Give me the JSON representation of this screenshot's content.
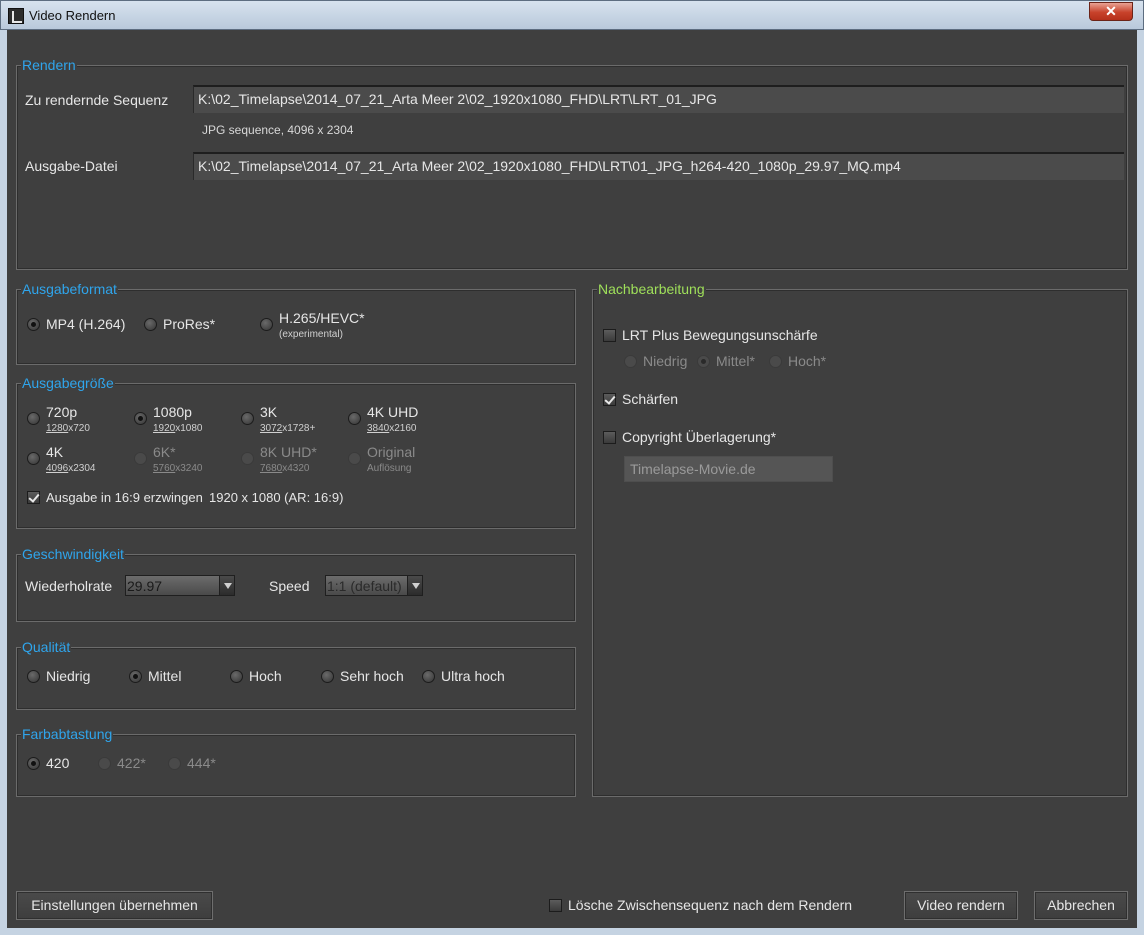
{
  "window": {
    "title": "Video Rendern",
    "close_symbol": "✕"
  },
  "render": {
    "legend": "Rendern",
    "sequence_label": "Zu rendernde Sequenz",
    "sequence_value": "K:\\02_Timelapse\\2014_07_21_Arta Meer 2\\02_1920x1080_FHD\\LRT\\LRT_01_JPG",
    "sequence_info": "JPG sequence, 4096 x 2304",
    "output_label": "Ausgabe-Datei",
    "output_value": "K:\\02_Timelapse\\2014_07_21_Arta Meer 2\\02_1920x1080_FHD\\LRT\\01_JPG_h264-420_1080p_29.97_MQ.mp4"
  },
  "format": {
    "legend": "Ausgabeformat",
    "options": [
      {
        "label": "MP4 (H.264)",
        "selected": true
      },
      {
        "label": "ProRes*",
        "selected": false
      },
      {
        "label": "H.265/HEVC*",
        "sub": "(experimental)",
        "selected": false
      }
    ]
  },
  "size": {
    "legend": "Ausgabegröße",
    "options": [
      {
        "label": "720p",
        "w": "1280",
        "h": "x720",
        "selected": false,
        "enabled": true
      },
      {
        "label": "1080p",
        "w": "1920",
        "h": "x1080",
        "selected": true,
        "enabled": true
      },
      {
        "label": "3K",
        "w": "3072",
        "h": "x1728+",
        "selected": false,
        "enabled": true
      },
      {
        "label": "4K UHD",
        "w": "3840",
        "h": "x2160",
        "selected": false,
        "enabled": true
      },
      {
        "label": "4K",
        "w": "4096",
        "h": "x2304",
        "selected": false,
        "enabled": true
      },
      {
        "label": "6K*",
        "w": "5760",
        "h": "x3240",
        "selected": false,
        "enabled": false
      },
      {
        "label": "8K UHD*",
        "w": "7680",
        "h": "x4320",
        "selected": false,
        "enabled": false
      },
      {
        "label": "Original",
        "sub": "Auflösung",
        "selected": false,
        "enabled": false
      }
    ],
    "force_169_label": "Ausgabe in 16:9 erzwingen",
    "force_169_checked": true,
    "force_169_info": "1920 x 1080 (AR: 16:9)"
  },
  "speed": {
    "legend": "Geschwindigkeit",
    "framerate_label": "Wiederholrate",
    "framerate_value": "29.97",
    "speed_label": "Speed",
    "speed_value": "1:1 (default)"
  },
  "quality": {
    "legend": "Qualität",
    "options": [
      {
        "label": "Niedrig",
        "selected": false
      },
      {
        "label": "Mittel",
        "selected": true
      },
      {
        "label": "Hoch",
        "selected": false
      },
      {
        "label": "Sehr hoch",
        "selected": false
      },
      {
        "label": "Ultra hoch",
        "selected": false
      }
    ]
  },
  "chroma": {
    "legend": "Farbabtastung",
    "options": [
      {
        "label": "420",
        "selected": true,
        "enabled": true
      },
      {
        "label": "422*",
        "selected": false,
        "enabled": false
      },
      {
        "label": "444*",
        "selected": false,
        "enabled": false
      }
    ]
  },
  "post": {
    "legend": "Nachbearbeitung",
    "motion_blur_label": "LRT Plus Bewegungsunschärfe",
    "motion_blur_checked": false,
    "blur_options": [
      {
        "label": "Niedrig",
        "selected": false
      },
      {
        "label": "Mittel*",
        "selected": true
      },
      {
        "label": "Hoch*",
        "selected": false
      }
    ],
    "sharpen_label": "Schärfen",
    "sharpen_checked": true,
    "copyright_label": "Copyright Überlagerung*",
    "copyright_checked": false,
    "copyright_text": "Timelapse-Movie.de"
  },
  "footer": {
    "apply_label": "Einstellungen übernehmen",
    "delete_label": "Lösche Zwischensequenz nach dem Rendern",
    "delete_checked": false,
    "render_label": "Video rendern",
    "cancel_label": "Abbrechen"
  }
}
